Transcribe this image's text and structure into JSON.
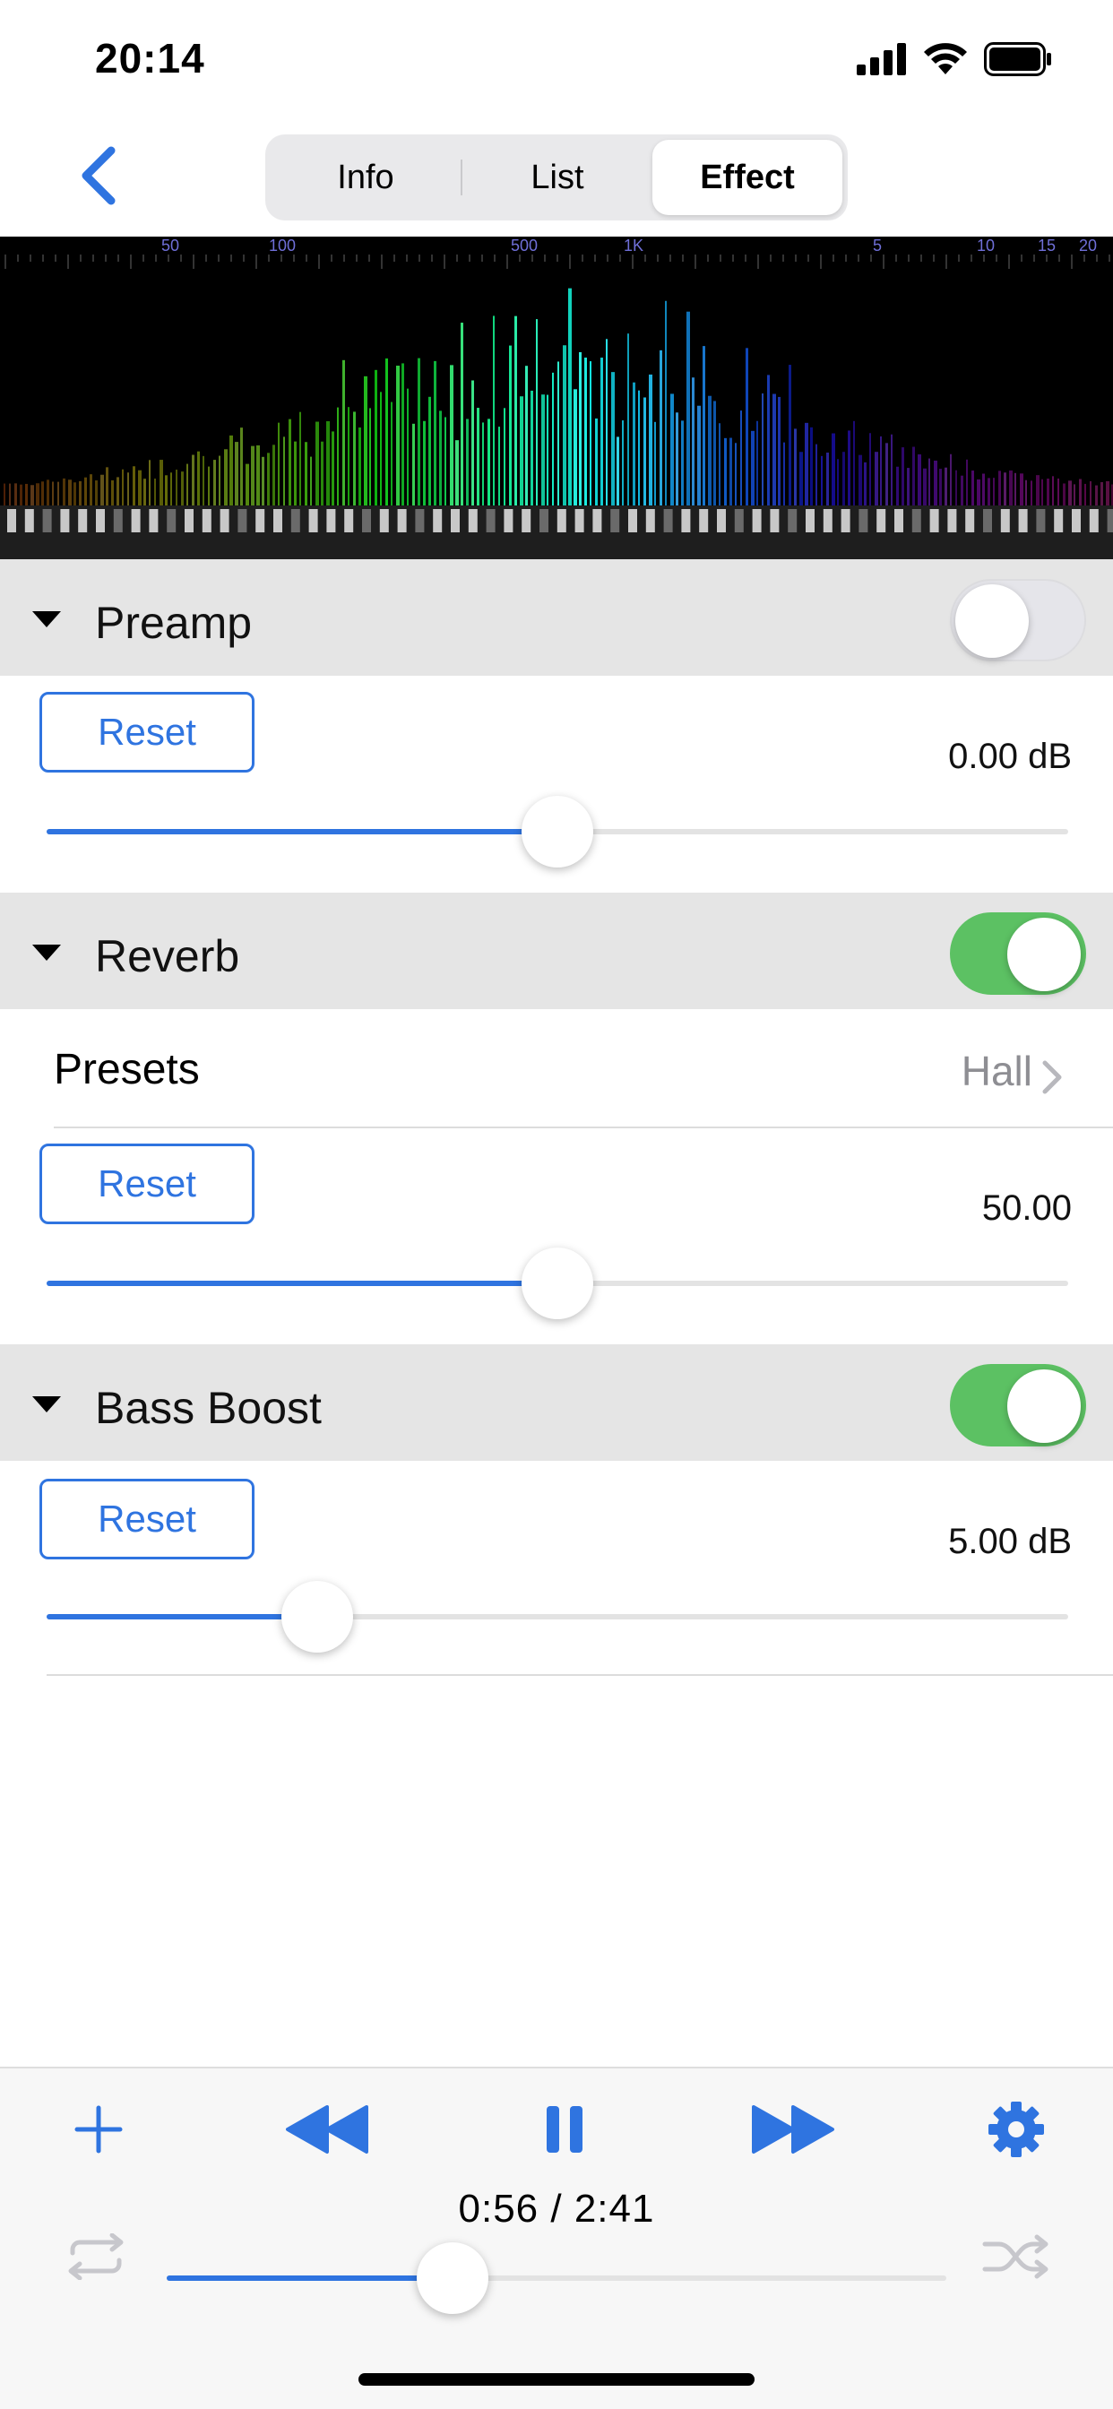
{
  "status": {
    "time": "20:14"
  },
  "nav": {
    "tabs": [
      {
        "label": "Info",
        "active": false
      },
      {
        "label": "List",
        "active": false
      },
      {
        "label": "Effect",
        "active": true
      }
    ]
  },
  "spectrum": {
    "freq_labels": [
      "50",
      "100",
      "500",
      "1K",
      "5",
      "10",
      "15",
      "20"
    ]
  },
  "sections": {
    "preamp": {
      "title": "Preamp",
      "enabled": false,
      "reset_label": "Reset",
      "value": "0.00 dB",
      "slider_fraction": 0.5
    },
    "reverb": {
      "title": "Reverb",
      "enabled": true,
      "presets_label": "Presets",
      "presets_value": "Hall",
      "reset_label": "Reset",
      "value": "50.00",
      "slider_fraction": 0.5
    },
    "bass_boost": {
      "title": "Bass Boost",
      "enabled": true,
      "reset_label": "Reset",
      "value": "5.00 dB",
      "slider_fraction": 0.265
    }
  },
  "player": {
    "time": "0:56 / 2:41",
    "progress_fraction": 0.367,
    "icons": [
      "add-icon",
      "rewind-icon",
      "pause-icon",
      "fast-forward-icon",
      "gear-icon",
      "repeat-icon",
      "shuffle-icon"
    ]
  },
  "colors": {
    "accent": "#2f74e0",
    "toggle_on": "#5cc163",
    "section_bg": "#e5e5e5"
  }
}
